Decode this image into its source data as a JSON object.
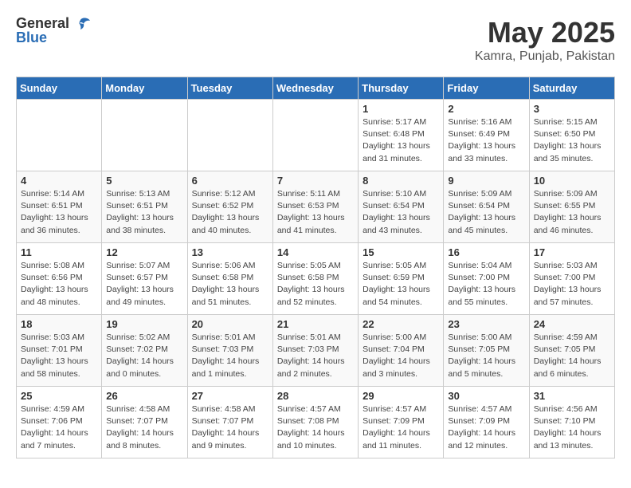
{
  "header": {
    "logo_general": "General",
    "logo_blue": "Blue",
    "title": "May 2025",
    "subtitle": "Kamra, Punjab, Pakistan"
  },
  "weekdays": [
    "Sunday",
    "Monday",
    "Tuesday",
    "Wednesday",
    "Thursday",
    "Friday",
    "Saturday"
  ],
  "weeks": [
    [
      {
        "day": "",
        "info": ""
      },
      {
        "day": "",
        "info": ""
      },
      {
        "day": "",
        "info": ""
      },
      {
        "day": "",
        "info": ""
      },
      {
        "day": "1",
        "info": "Sunrise: 5:17 AM\nSunset: 6:48 PM\nDaylight: 13 hours\nand 31 minutes."
      },
      {
        "day": "2",
        "info": "Sunrise: 5:16 AM\nSunset: 6:49 PM\nDaylight: 13 hours\nand 33 minutes."
      },
      {
        "day": "3",
        "info": "Sunrise: 5:15 AM\nSunset: 6:50 PM\nDaylight: 13 hours\nand 35 minutes."
      }
    ],
    [
      {
        "day": "4",
        "info": "Sunrise: 5:14 AM\nSunset: 6:51 PM\nDaylight: 13 hours\nand 36 minutes."
      },
      {
        "day": "5",
        "info": "Sunrise: 5:13 AM\nSunset: 6:51 PM\nDaylight: 13 hours\nand 38 minutes."
      },
      {
        "day": "6",
        "info": "Sunrise: 5:12 AM\nSunset: 6:52 PM\nDaylight: 13 hours\nand 40 minutes."
      },
      {
        "day": "7",
        "info": "Sunrise: 5:11 AM\nSunset: 6:53 PM\nDaylight: 13 hours\nand 41 minutes."
      },
      {
        "day": "8",
        "info": "Sunrise: 5:10 AM\nSunset: 6:54 PM\nDaylight: 13 hours\nand 43 minutes."
      },
      {
        "day": "9",
        "info": "Sunrise: 5:09 AM\nSunset: 6:54 PM\nDaylight: 13 hours\nand 45 minutes."
      },
      {
        "day": "10",
        "info": "Sunrise: 5:09 AM\nSunset: 6:55 PM\nDaylight: 13 hours\nand 46 minutes."
      }
    ],
    [
      {
        "day": "11",
        "info": "Sunrise: 5:08 AM\nSunset: 6:56 PM\nDaylight: 13 hours\nand 48 minutes."
      },
      {
        "day": "12",
        "info": "Sunrise: 5:07 AM\nSunset: 6:57 PM\nDaylight: 13 hours\nand 49 minutes."
      },
      {
        "day": "13",
        "info": "Sunrise: 5:06 AM\nSunset: 6:58 PM\nDaylight: 13 hours\nand 51 minutes."
      },
      {
        "day": "14",
        "info": "Sunrise: 5:05 AM\nSunset: 6:58 PM\nDaylight: 13 hours\nand 52 minutes."
      },
      {
        "day": "15",
        "info": "Sunrise: 5:05 AM\nSunset: 6:59 PM\nDaylight: 13 hours\nand 54 minutes."
      },
      {
        "day": "16",
        "info": "Sunrise: 5:04 AM\nSunset: 7:00 PM\nDaylight: 13 hours\nand 55 minutes."
      },
      {
        "day": "17",
        "info": "Sunrise: 5:03 AM\nSunset: 7:00 PM\nDaylight: 13 hours\nand 57 minutes."
      }
    ],
    [
      {
        "day": "18",
        "info": "Sunrise: 5:03 AM\nSunset: 7:01 PM\nDaylight: 13 hours\nand 58 minutes."
      },
      {
        "day": "19",
        "info": "Sunrise: 5:02 AM\nSunset: 7:02 PM\nDaylight: 14 hours\nand 0 minutes."
      },
      {
        "day": "20",
        "info": "Sunrise: 5:01 AM\nSunset: 7:03 PM\nDaylight: 14 hours\nand 1 minutes."
      },
      {
        "day": "21",
        "info": "Sunrise: 5:01 AM\nSunset: 7:03 PM\nDaylight: 14 hours\nand 2 minutes."
      },
      {
        "day": "22",
        "info": "Sunrise: 5:00 AM\nSunset: 7:04 PM\nDaylight: 14 hours\nand 3 minutes."
      },
      {
        "day": "23",
        "info": "Sunrise: 5:00 AM\nSunset: 7:05 PM\nDaylight: 14 hours\nand 5 minutes."
      },
      {
        "day": "24",
        "info": "Sunrise: 4:59 AM\nSunset: 7:05 PM\nDaylight: 14 hours\nand 6 minutes."
      }
    ],
    [
      {
        "day": "25",
        "info": "Sunrise: 4:59 AM\nSunset: 7:06 PM\nDaylight: 14 hours\nand 7 minutes."
      },
      {
        "day": "26",
        "info": "Sunrise: 4:58 AM\nSunset: 7:07 PM\nDaylight: 14 hours\nand 8 minutes."
      },
      {
        "day": "27",
        "info": "Sunrise: 4:58 AM\nSunset: 7:07 PM\nDaylight: 14 hours\nand 9 minutes."
      },
      {
        "day": "28",
        "info": "Sunrise: 4:57 AM\nSunset: 7:08 PM\nDaylight: 14 hours\nand 10 minutes."
      },
      {
        "day": "29",
        "info": "Sunrise: 4:57 AM\nSunset: 7:09 PM\nDaylight: 14 hours\nand 11 minutes."
      },
      {
        "day": "30",
        "info": "Sunrise: 4:57 AM\nSunset: 7:09 PM\nDaylight: 14 hours\nand 12 minutes."
      },
      {
        "day": "31",
        "info": "Sunrise: 4:56 AM\nSunset: 7:10 PM\nDaylight: 14 hours\nand 13 minutes."
      }
    ]
  ]
}
